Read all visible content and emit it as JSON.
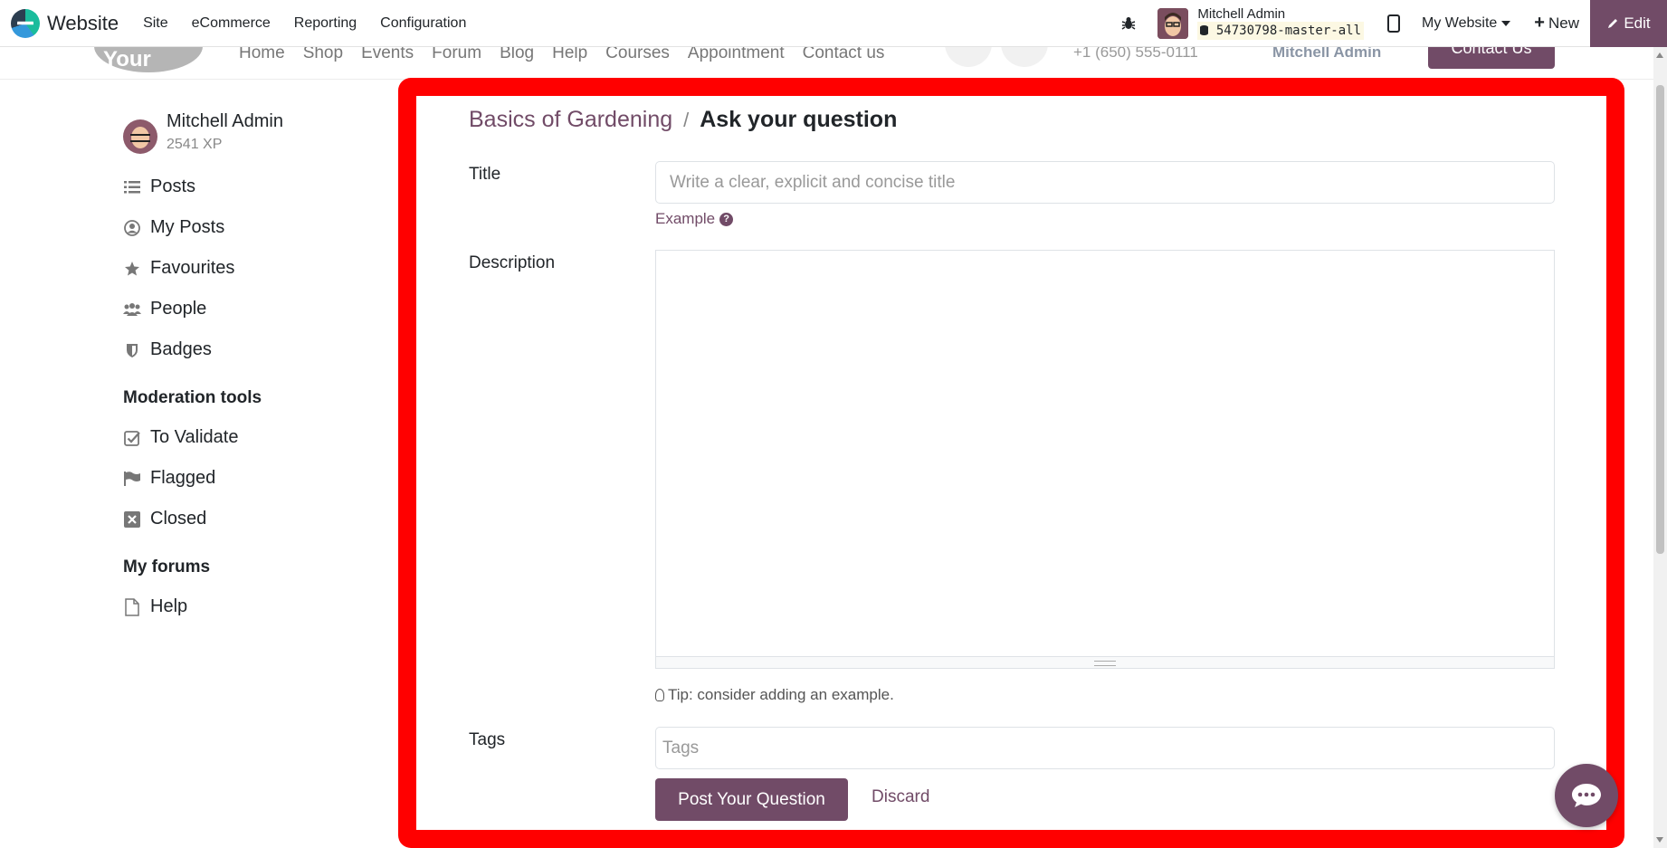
{
  "navbar": {
    "app_name": "Website",
    "menu": [
      "Site",
      "eCommerce",
      "Reporting",
      "Configuration"
    ],
    "user_name": "Mitchell Admin",
    "db_name": "54730798-master-all",
    "website_switcher": "My Website",
    "new_label": "New",
    "edit_label": "Edit"
  },
  "site_header": {
    "logo_text": "Your Logo",
    "nav": [
      "Home",
      "Shop",
      "Events",
      "Forum",
      "Blog",
      "Help",
      "Courses",
      "Appointment",
      "Contact us"
    ],
    "phone": "+1 (650) 555-0111",
    "user": "Mitchell Admin",
    "contact_btn": "Contact Us"
  },
  "sidebar": {
    "user_name": "Mitchell Admin",
    "xp": "2541 XP",
    "items": [
      {
        "label": "Posts",
        "icon": "list-icon"
      },
      {
        "label": "My Posts",
        "icon": "user-circle-icon"
      },
      {
        "label": "Favourites",
        "icon": "star-icon"
      },
      {
        "label": "People",
        "icon": "users-icon"
      },
      {
        "label": "Badges",
        "icon": "shield-icon"
      }
    ],
    "moderation_title": "Moderation tools",
    "moderation": [
      {
        "label": "To Validate",
        "icon": "check-square-icon"
      },
      {
        "label": "Flagged",
        "icon": "flag-icon"
      },
      {
        "label": "Closed",
        "icon": "close-square-icon"
      }
    ],
    "forums_title": "My forums",
    "forums": [
      {
        "label": "Help",
        "icon": "file-icon"
      }
    ]
  },
  "form": {
    "breadcrumb_parent": "Basics of Gardening",
    "breadcrumb_sep": "/",
    "breadcrumb_current": "Ask your question",
    "title_label": "Title",
    "title_placeholder": "Write a clear, explicit and concise title",
    "title_value": "",
    "example_link": "Example",
    "description_label": "Description",
    "tip": "Tip: consider adding an example.",
    "tags_label": "Tags",
    "tags_placeholder": "Tags",
    "post_button": "Post Your Question",
    "discard_button": "Discard"
  },
  "colors": {
    "primary": "#714b67",
    "highlight_frame": "#ff0000"
  }
}
